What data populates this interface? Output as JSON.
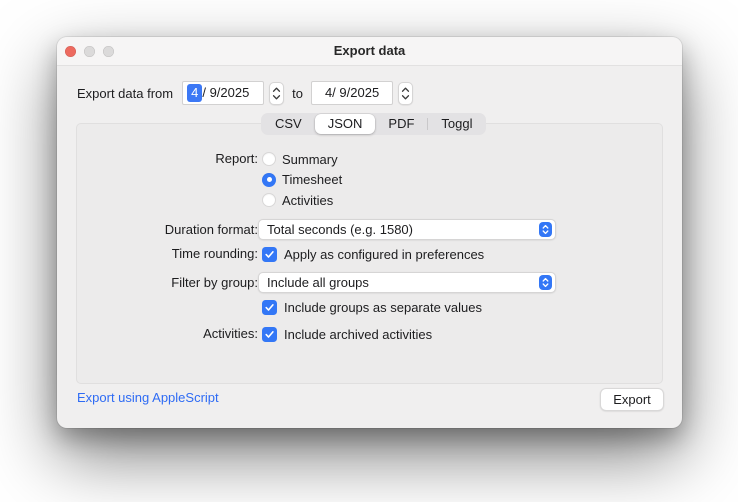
{
  "window": {
    "title": "Export data"
  },
  "date_range": {
    "label": "Export data from",
    "to_label": "to",
    "from_selected": "4",
    "from_rest": "/ 9/2025",
    "to_value": "4/ 9/2025"
  },
  "tabs": {
    "items": [
      {
        "label": "CSV",
        "selected": false
      },
      {
        "label": "JSON",
        "selected": true
      },
      {
        "label": "PDF",
        "selected": false
      },
      {
        "label": "Toggl",
        "selected": false
      }
    ]
  },
  "form": {
    "report": {
      "label": "Report:",
      "options": [
        {
          "label": "Summary",
          "selected": false
        },
        {
          "label": "Timesheet",
          "selected": true
        },
        {
          "label": "Activities",
          "selected": false
        }
      ]
    },
    "duration_format": {
      "label": "Duration format:",
      "value": "Total seconds (e.g. 1580)"
    },
    "time_rounding": {
      "label": "Time rounding:",
      "option": "Apply as configured in preferences",
      "checked": true
    },
    "filter_by_group": {
      "label": "Filter by group:",
      "value": "Include all groups"
    },
    "include_groups": {
      "option": "Include groups as separate values",
      "checked": true
    },
    "activities": {
      "label": "Activities:",
      "option": "Include archived activities",
      "checked": true
    }
  },
  "footer": {
    "applescript_link": "Export using AppleScript",
    "export_button": "Export"
  },
  "colors": {
    "accent_blue": "#3377f6",
    "selection_blue": "#3c78f5",
    "link_blue": "#2e6bf4",
    "traffic_red": "#ed6a5f"
  }
}
